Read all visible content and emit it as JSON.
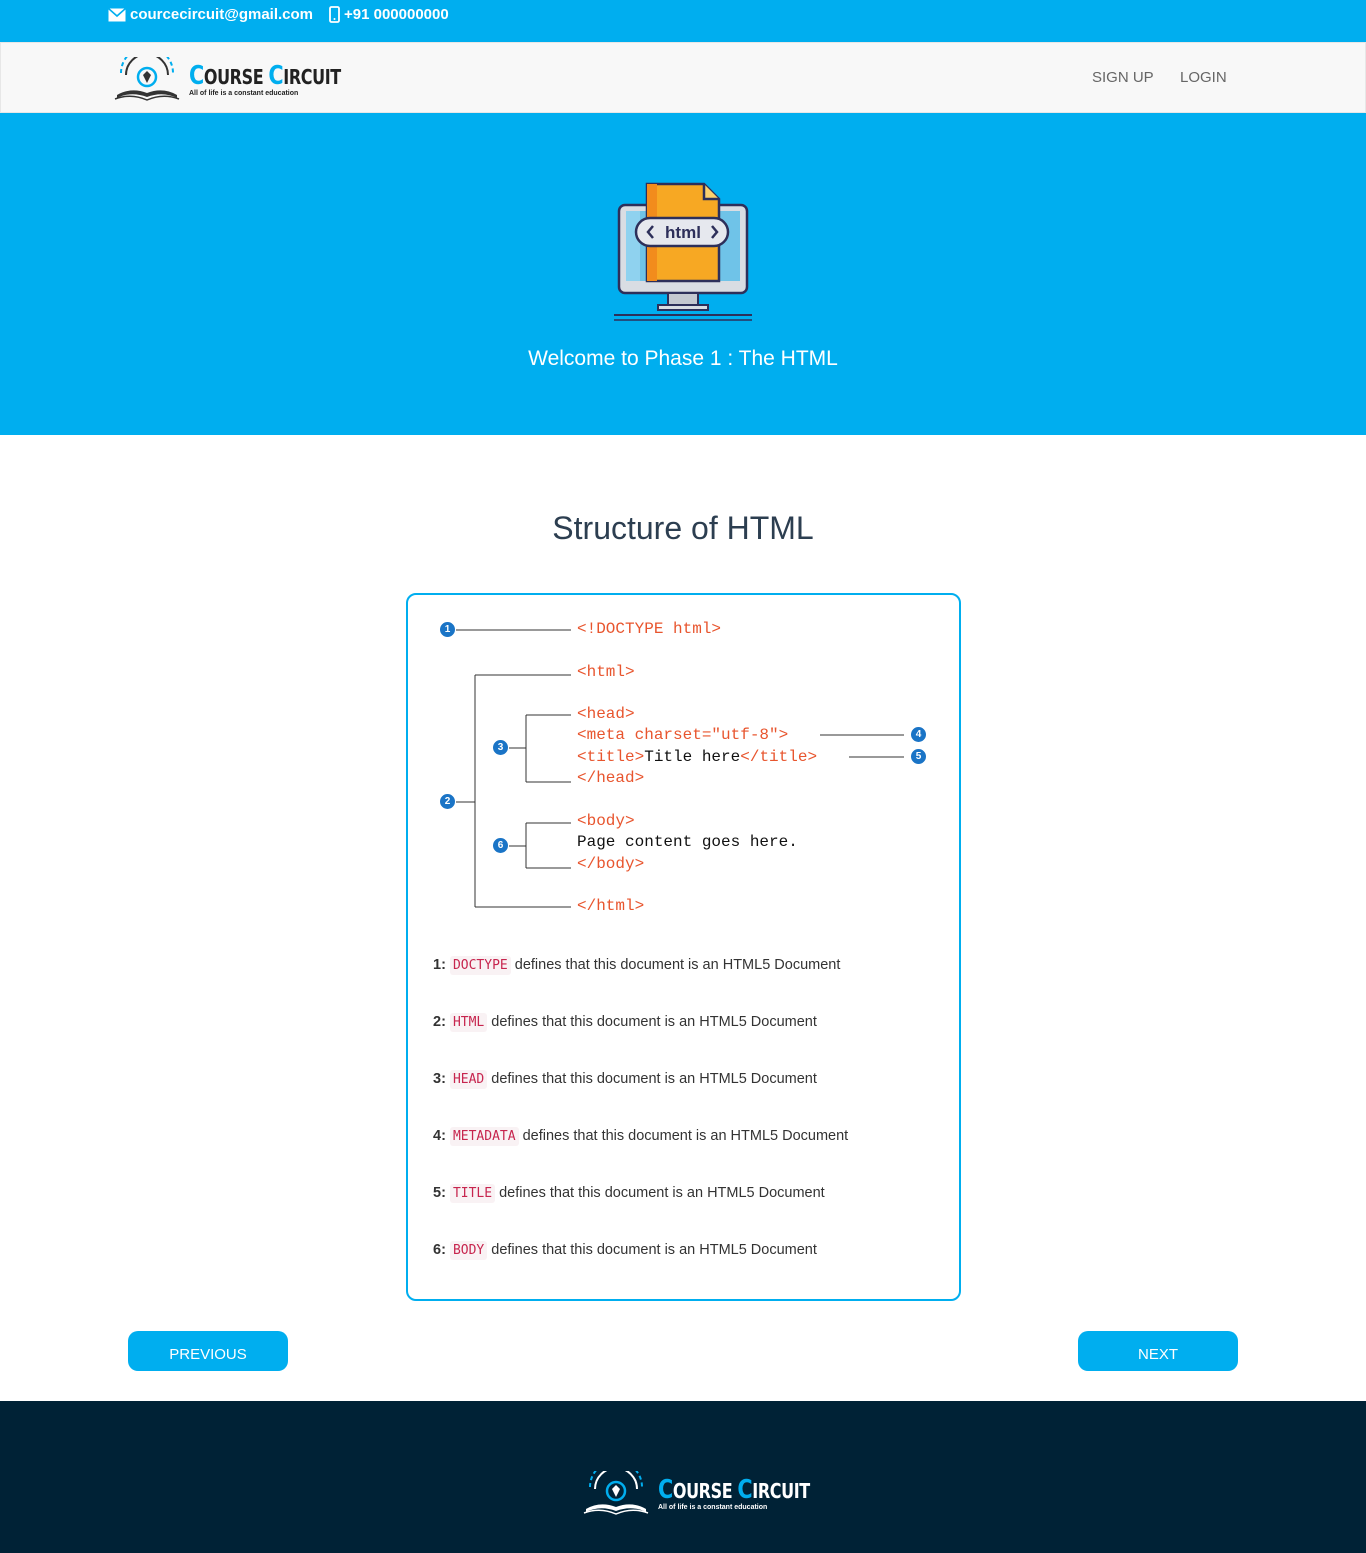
{
  "topbar": {
    "email_icon": "envelope-icon",
    "email": "courcecircuit@gmail.com",
    "phone_icon": "mobile-phone-icon",
    "phone": "+91 000000000"
  },
  "navbar": {
    "logo": {
      "brand_first_cap": "C",
      "brand_rest1": "OURSE ",
      "brand_second_cap": "C",
      "brand_rest2": "IRCUIT",
      "tagline": "All of life is a constant education"
    },
    "links": [
      {
        "label": "SIGN UP"
      },
      {
        "label": "LOGIN"
      }
    ]
  },
  "hero": {
    "illustration_icon": "html-monitor-icon",
    "illustration_label": "html",
    "title": "Welcome to Phase 1 : The HTML"
  },
  "main": {
    "title": "Structure of HTML",
    "diagram": {
      "lines": [
        {
          "text": "<!DOCTYPE html>"
        },
        {
          "text": "<html>"
        },
        {
          "text": "<head>"
        },
        {
          "text": "<meta charset=\"utf-8\">"
        },
        {
          "tag_open": "<title>",
          "content": "Title here",
          "tag_close": "</title>"
        },
        {
          "text": "</head>"
        },
        {
          "text": "<body>"
        },
        {
          "content": "Page content goes here."
        },
        {
          "text": "</body>"
        },
        {
          "text": "</html>"
        }
      ],
      "markers": [
        "1",
        "2",
        "3",
        "4",
        "5",
        "6"
      ]
    },
    "definitions": [
      {
        "num": "1:",
        "code": "DOCTYPE",
        "text": " defines that this document is an HTML5 Document"
      },
      {
        "num": "2:",
        "code": "HTML",
        "text": " defines that this document is an HTML5 Document"
      },
      {
        "num": "3:",
        "code": "HEAD",
        "text": " defines that this document is an HTML5 Document"
      },
      {
        "num": "4:",
        "code": "METADATA",
        "text": " defines that this document is an HTML5 Document"
      },
      {
        "num": "5:",
        "code": "TITLE",
        "text": " defines that this document is an HTML5 Document"
      },
      {
        "num": "6:",
        "code": "BODY",
        "text": " defines that this document is an HTML5 Document"
      }
    ]
  },
  "pager": {
    "previous": "PREVIOUS",
    "next": "NEXT"
  },
  "footer": {
    "logo": {
      "brand_first_cap": "C",
      "brand_rest1": "OURSE ",
      "brand_second_cap": "C",
      "brand_rest2": "IRCUIT",
      "tagline": "All of life is a constant education"
    }
  },
  "colors": {
    "accent": "#00aeef",
    "footer_bg": "#002236",
    "code_tag": "#e8552e",
    "marker": "#1a74c6"
  }
}
